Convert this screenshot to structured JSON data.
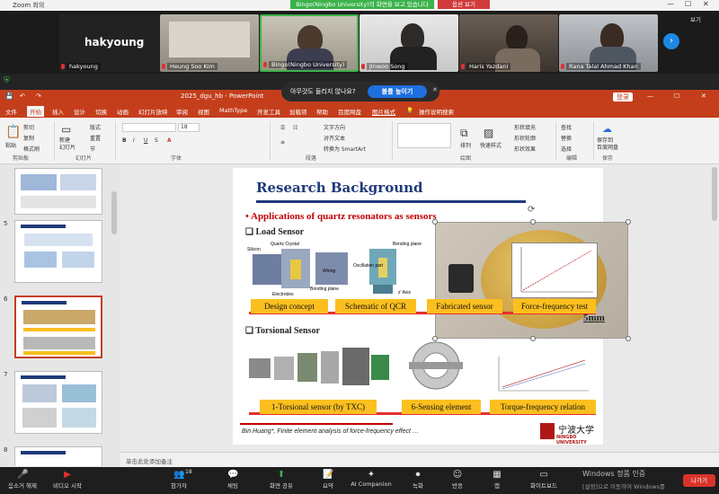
{
  "zoom": {
    "window_title": "Zoom 회의",
    "share_banner": "Bingo(Ningbo University)의 화면을 보고 있습니다",
    "stop_label": "옵션 보기",
    "view_label": "보기",
    "participants": [
      {
        "name": "hakyoung",
        "big_name": "hakyoung"
      },
      {
        "name": "Heung Soo Kim"
      },
      {
        "name": "Bingo(Ningbo University)"
      },
      {
        "name": "Jinwoo Song"
      },
      {
        "name": "Haris Yazdani"
      },
      {
        "name": "Rana Talal Ahmad Khan"
      }
    ]
  },
  "overlay": {
    "question": "아무것도 들리지 않나요?",
    "button": "볼륨 높이기"
  },
  "ppt": {
    "file_title": "2025_dgu_hb  -  PowerPoint",
    "login": "登录",
    "tabs": [
      "文件",
      "开始",
      "插入",
      "设计",
      "切换",
      "动画",
      "幻灯片放映",
      "审阅",
      "视图",
      "MathType",
      "开发工具",
      "加载项",
      "帮助",
      "百度网盘",
      "图片格式"
    ],
    "search": "操作说明搜索",
    "ribbon": {
      "paste": "粘贴",
      "cut": "剪切",
      "copy": "复制",
      "format_painter": "格式刷",
      "new_slide": "新建\n幻灯片",
      "layout": "版式",
      "reset": "重置",
      "section": "节",
      "font_size": "18",
      "text_dir": "文字方向",
      "align_text": "对齐文本",
      "smartart": "转换为 SmartArt",
      "arrange": "排列",
      "quick_styles": "快速样式",
      "shape_fill": "形状填充",
      "shape_outline": "形状轮廓",
      "shape_effects": "形状效果",
      "find": "查找",
      "replace": "替换",
      "select": "选择",
      "save_to_baidu": "保存到\n百度网盘",
      "groups": [
        "剪贴板",
        "幻灯片",
        "字体",
        "段落",
        "绘图",
        "编辑",
        "保存"
      ]
    },
    "thumb_numbers": [
      "5",
      "6",
      "7",
      "8"
    ],
    "notes": "单击此处添加备注"
  },
  "slide": {
    "title": "Research Background",
    "bullet": "Applications of quartz resonators as sensors",
    "load_sensor": "Load Sensor",
    "torsional_sensor": "Torsional Sensor",
    "captions": [
      "Design concept",
      "Schematic of QCR",
      "Fabricated sensor",
      "Force-frequency test"
    ],
    "captions2": [
      "1-Torsional sensor (by TXC)",
      "6-Sensing element",
      "Torque-frequency relation"
    ],
    "scale": "5mm",
    "citation": "Bin Huang*, Finite element analysis of force-frequency effect …",
    "university": "NINGBO UNIVERSITY",
    "university_cn": "宁波大学",
    "fig_labels": [
      "Silicon",
      "Quartz Crystal",
      "Wiring",
      "Electrodes",
      "Bonding plane",
      "Bending plane",
      "Oscillation part",
      "z' Axis"
    ]
  },
  "taskbar": {
    "items": [
      "음소거 해제",
      "비디오 시작",
      "참가자",
      "채팅",
      "화면 공유",
      "요약",
      "AI Companion",
      "녹화",
      "반응",
      "앱",
      "화이트보드",
      "나가기"
    ],
    "participant_count": "18",
    "windows_activate_1": "Windows 정품 인증",
    "windows_activate_2": "[설정]으로 이동하여 Windows를"
  },
  "colors": {
    "ppt_red": "#c43e1c",
    "zoom_green": "#3cb34a",
    "caption_yellow": "#fbbf1f",
    "leave_red": "#d9342b",
    "title_blue": "#1f3a7a"
  }
}
